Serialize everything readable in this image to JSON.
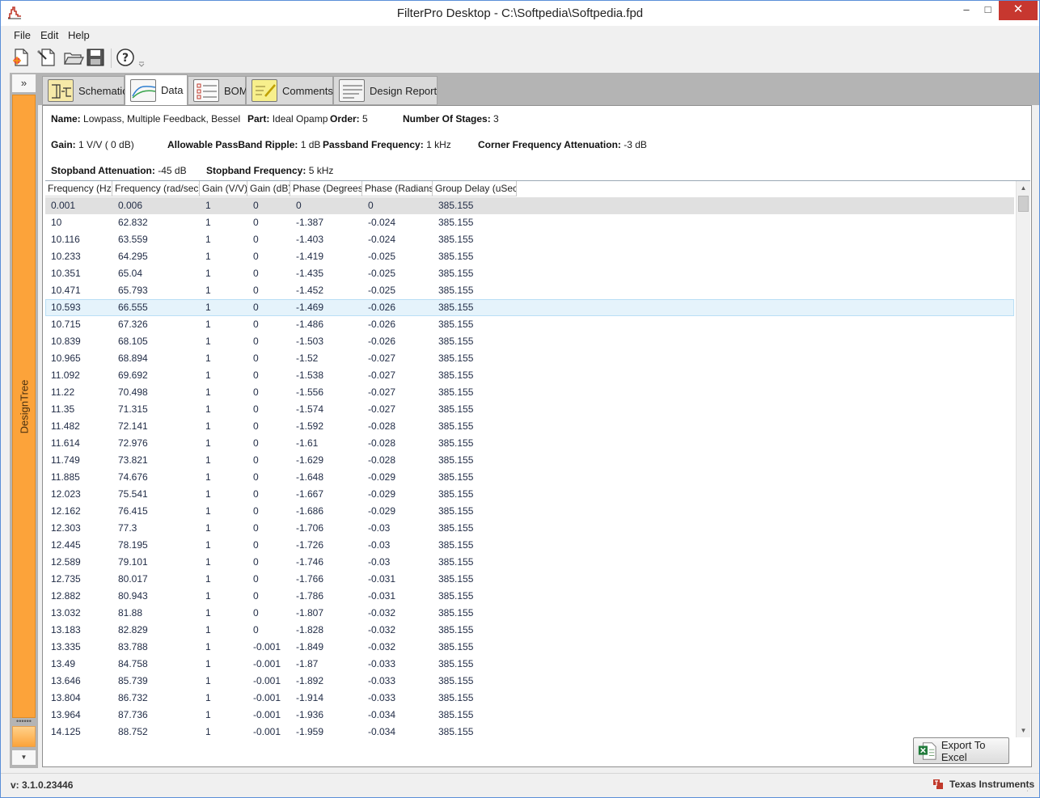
{
  "window": {
    "title": "FilterPro Desktop - C:\\Softpedia\\Softpedia.fpd",
    "min_glyph": "‒",
    "max_glyph": "□",
    "close_glyph": "✕"
  },
  "menu": [
    {
      "label": "File"
    },
    {
      "label": "Edit"
    },
    {
      "label": "Help"
    }
  ],
  "toolbar": {
    "icons": [
      "new-file-icon",
      "new-wizard-icon",
      "open-folder-icon",
      "save-icon",
      "help-icon"
    ]
  },
  "left_panel": {
    "expand_label": "»",
    "designtree_label": "DesignTree",
    "grip_glyph": "••••••",
    "down_glyph": "▼"
  },
  "tabs": [
    {
      "label": "Schematic",
      "icon": "schematic-icon"
    },
    {
      "label": "Data",
      "icon": "data-chart-icon",
      "active": true
    },
    {
      "label": "BOM",
      "icon": "bom-list-icon"
    },
    {
      "label": "Comments",
      "icon": "comments-note-icon"
    },
    {
      "label": "Design Report",
      "icon": "report-doc-icon"
    }
  ],
  "info": {
    "name_label": "Name:",
    "name_value": "Lowpass, Multiple Feedback, Bessel",
    "part_label": "Part:",
    "part_value": "Ideal Opamp",
    "order_label": "Order:",
    "order_value": "5",
    "stages_label": "Number Of Stages:",
    "stages_value": "3",
    "gain_label": "Gain:",
    "gain_value": "1 V/V ( 0 dB)",
    "ripple_label": "Allowable PassBand Ripple:",
    "ripple_value": "1 dB",
    "passband_label": "Passband Frequency:",
    "passband_value": "1 kHz",
    "corner_label": "Corner Frequency Attenuation:",
    "corner_value": "-3 dB",
    "stopband_att_label": "Stopband Attenuation:",
    "stopband_att_value": "-45 dB",
    "stopband_freq_label": "Stopband Frequency:",
    "stopband_freq_value": "5 kHz"
  },
  "grid": {
    "columns": [
      "Frequency (Hz)",
      "Frequency (rad/sec)",
      "Gain (V/V)",
      "Gain (dB)",
      "Phase (Degrees)",
      "Phase (Radians)",
      "Group Delay (uSec)"
    ],
    "rows": [
      [
        "0.001",
        "0.006",
        "1",
        "0",
        "0",
        "0",
        "385.155"
      ],
      [
        "10",
        "62.832",
        "1",
        "0",
        "-1.387",
        "-0.024",
        "385.155"
      ],
      [
        "10.116",
        "63.559",
        "1",
        "0",
        "-1.403",
        "-0.024",
        "385.155"
      ],
      [
        "10.233",
        "64.295",
        "1",
        "0",
        "-1.419",
        "-0.025",
        "385.155"
      ],
      [
        "10.351",
        "65.04",
        "1",
        "0",
        "-1.435",
        "-0.025",
        "385.155"
      ],
      [
        "10.471",
        "65.793",
        "1",
        "0",
        "-1.452",
        "-0.025",
        "385.155"
      ],
      [
        "10.593",
        "66.555",
        "1",
        "0",
        "-1.469",
        "-0.026",
        "385.155"
      ],
      [
        "10.715",
        "67.326",
        "1",
        "0",
        "-1.486",
        "-0.026",
        "385.155"
      ],
      [
        "10.839",
        "68.105",
        "1",
        "0",
        "-1.503",
        "-0.026",
        "385.155"
      ],
      [
        "10.965",
        "68.894",
        "1",
        "0",
        "-1.52",
        "-0.027",
        "385.155"
      ],
      [
        "11.092",
        "69.692",
        "1",
        "0",
        "-1.538",
        "-0.027",
        "385.155"
      ],
      [
        "11.22",
        "70.498",
        "1",
        "0",
        "-1.556",
        "-0.027",
        "385.155"
      ],
      [
        "11.35",
        "71.315",
        "1",
        "0",
        "-1.574",
        "-0.027",
        "385.155"
      ],
      [
        "11.482",
        "72.141",
        "1",
        "0",
        "-1.592",
        "-0.028",
        "385.155"
      ],
      [
        "11.614",
        "72.976",
        "1",
        "0",
        "-1.61",
        "-0.028",
        "385.155"
      ],
      [
        "11.749",
        "73.821",
        "1",
        "0",
        "-1.629",
        "-0.028",
        "385.155"
      ],
      [
        "11.885",
        "74.676",
        "1",
        "0",
        "-1.648",
        "-0.029",
        "385.155"
      ],
      [
        "12.023",
        "75.541",
        "1",
        "0",
        "-1.667",
        "-0.029",
        "385.155"
      ],
      [
        "12.162",
        "76.415",
        "1",
        "0",
        "-1.686",
        "-0.029",
        "385.155"
      ],
      [
        "12.303",
        "77.3",
        "1",
        "0",
        "-1.706",
        "-0.03",
        "385.155"
      ],
      [
        "12.445",
        "78.195",
        "1",
        "0",
        "-1.726",
        "-0.03",
        "385.155"
      ],
      [
        "12.589",
        "79.101",
        "1",
        "0",
        "-1.746",
        "-0.03",
        "385.155"
      ],
      [
        "12.735",
        "80.017",
        "1",
        "0",
        "-1.766",
        "-0.031",
        "385.155"
      ],
      [
        "12.882",
        "80.943",
        "1",
        "0",
        "-1.786",
        "-0.031",
        "385.155"
      ],
      [
        "13.032",
        "81.88",
        "1",
        "0",
        "-1.807",
        "-0.032",
        "385.155"
      ],
      [
        "13.183",
        "82.829",
        "1",
        "0",
        "-1.828",
        "-0.032",
        "385.155"
      ],
      [
        "13.335",
        "83.788",
        "1",
        "-0.001",
        "-1.849",
        "-0.032",
        "385.155"
      ],
      [
        "13.49",
        "84.758",
        "1",
        "-0.001",
        "-1.87",
        "-0.033",
        "385.155"
      ],
      [
        "13.646",
        "85.739",
        "1",
        "-0.001",
        "-1.892",
        "-0.033",
        "385.155"
      ],
      [
        "13.804",
        "86.732",
        "1",
        "-0.001",
        "-1.914",
        "-0.033",
        "385.155"
      ],
      [
        "13.964",
        "87.736",
        "1",
        "-0.001",
        "-1.936",
        "-0.034",
        "385.155"
      ],
      [
        "14.125",
        "88.752",
        "1",
        "-0.001",
        "-1.959",
        "-0.034",
        "385.155"
      ]
    ],
    "selected_row": 0,
    "hover_row": 6,
    "scroll_up_glyph": "▲",
    "scroll_down_glyph": "▼"
  },
  "export_button": {
    "label": "Export To Excel",
    "icon": "excel-icon"
  },
  "status": {
    "version": "v: 3.1.0.23446",
    "brand": "Texas Instruments",
    "brand_icon": "ti-logo-icon",
    "grip_glyph": "⋰"
  },
  "colors": {
    "designtree_orange": "#fca33a",
    "close_red": "#c7372f",
    "hover_row": "#e5f3fb",
    "selected_row": "#e0e0e0"
  }
}
